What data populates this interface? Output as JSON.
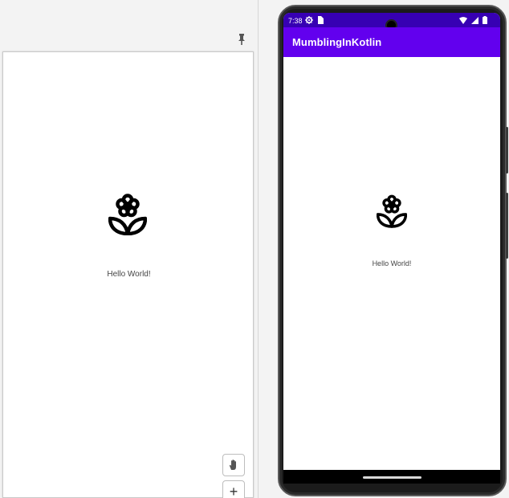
{
  "preview": {
    "text": "Hello World!",
    "icons": {
      "pin": "pin-icon",
      "flower": "flower-icon",
      "pan": "hand-icon",
      "zoom_in": "+"
    }
  },
  "device": {
    "status_bar": {
      "time": "7:38",
      "icons": [
        "settings-icon",
        "sim-card-icon",
        "wifi-icon",
        "signal-icon",
        "battery-icon"
      ]
    },
    "app_bar": {
      "title": "MumblingInKotlin"
    },
    "content": {
      "text": "Hello World!"
    },
    "colors": {
      "status_bar": "#3700b3",
      "app_bar": "#6200ee",
      "nav_bar": "#000000"
    }
  }
}
